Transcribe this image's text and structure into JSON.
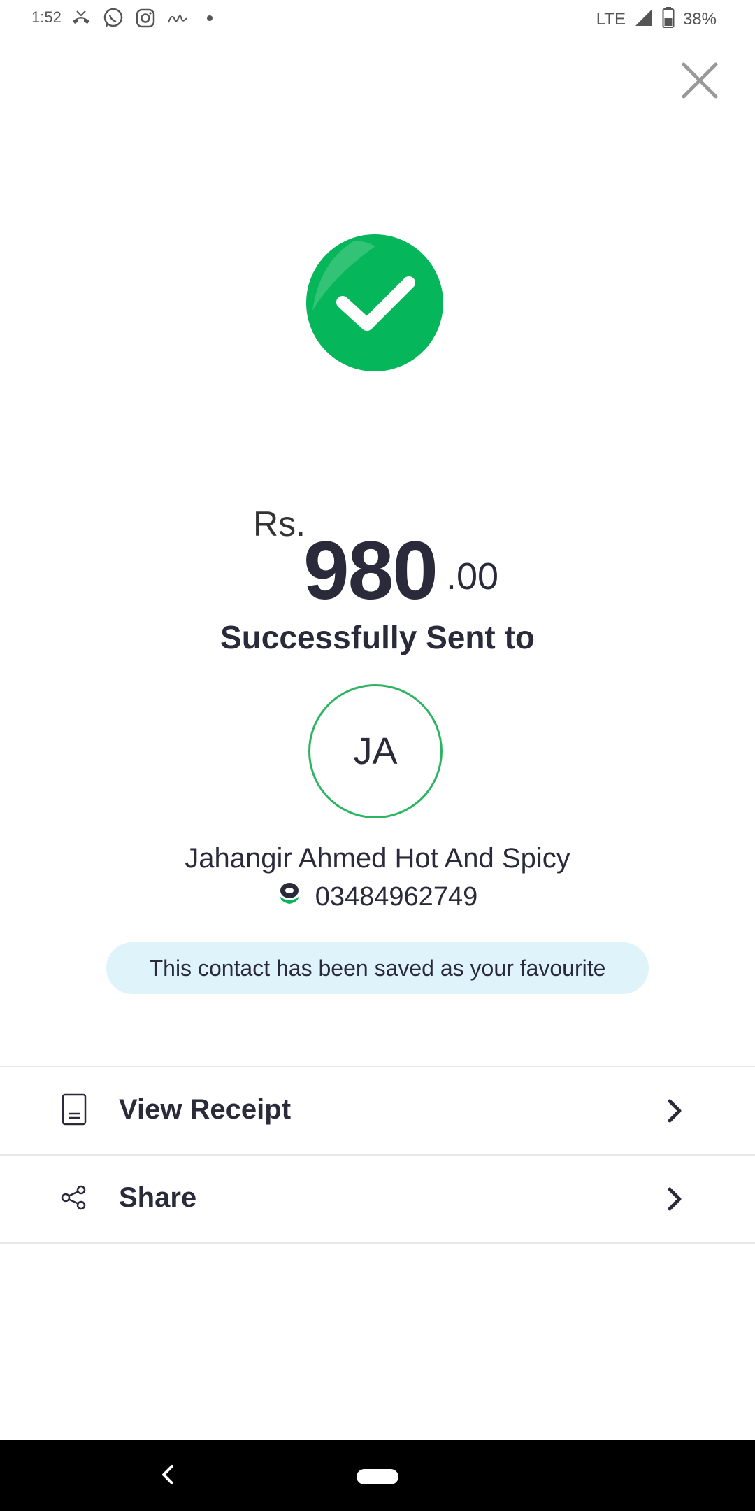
{
  "status_bar": {
    "time": "1:52",
    "network": "LTE",
    "battery": "38%",
    "icons": [
      "missed-call-icon",
      "whatsapp-icon",
      "instagram-icon",
      "signature-icon",
      "dot-icon"
    ]
  },
  "header": {
    "close_icon": "close-icon"
  },
  "transaction": {
    "currency": "Rs.",
    "amount_main": "980",
    "amount_decimal": ".00",
    "status_text": "Successfully Sent to",
    "status_color": "#05b65a"
  },
  "recipient": {
    "initials": "JA",
    "name": "Jahangir Ahmed Hot And Spicy",
    "phone": "03484962749",
    "favourite_message": "This contact has been saved as your favourite"
  },
  "actions": [
    {
      "label": "View Receipt",
      "icon": "receipt-icon"
    },
    {
      "label": "Share",
      "icon": "share-icon"
    }
  ],
  "colors": {
    "accent_green": "#05b65a",
    "badge_bg": "#dff3fb",
    "text_dark": "#2a2a3a"
  }
}
